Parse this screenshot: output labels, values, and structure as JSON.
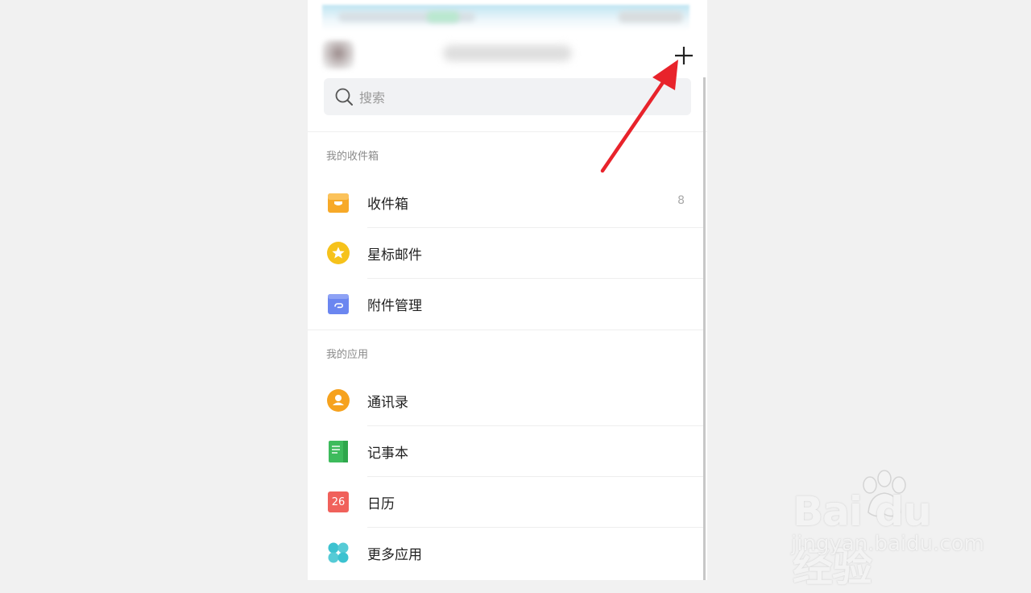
{
  "search": {
    "placeholder": "搜索"
  },
  "sections": [
    {
      "title": "我的收件箱"
    },
    {
      "title": "我的应用"
    }
  ],
  "mailbox_items": [
    {
      "label": "收件箱",
      "count": "8",
      "icon": "inbox-tray-icon",
      "color": "#f7a928"
    },
    {
      "label": "星标邮件",
      "icon": "star-icon",
      "color": "#f6c21b"
    },
    {
      "label": "附件管理",
      "icon": "attachment-icon",
      "color": "#6b86f0"
    }
  ],
  "app_items": [
    {
      "label": "通讯录",
      "icon": "contacts-icon",
      "color": "#f6a21e"
    },
    {
      "label": "记事本",
      "icon": "notepad-icon",
      "color": "#3dbb5c"
    },
    {
      "label": "日历",
      "icon": "calendar-icon",
      "color": "#f0615b",
      "calendar_day": "26"
    },
    {
      "label": "更多应用",
      "icon": "more-apps-icon",
      "color": "#3cc2d0"
    }
  ],
  "annotation": {
    "arrow_color": "#e8232b"
  },
  "watermark": {
    "brand": "Bai du 经验",
    "url": "jingyan.baidu.com"
  }
}
